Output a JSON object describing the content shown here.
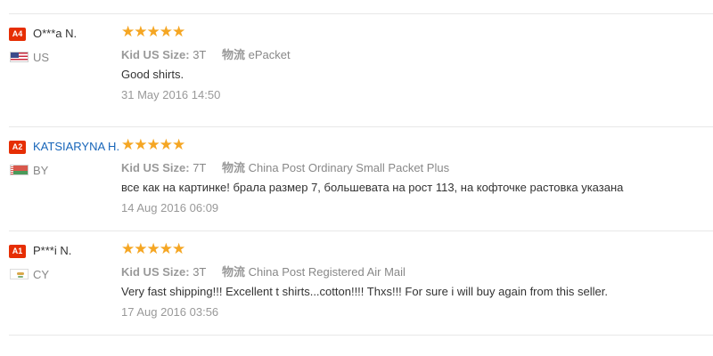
{
  "reviews": [
    {
      "badge": "A4",
      "name": "O***a N.",
      "name_is_link": false,
      "country": "US",
      "flag_icon": "us-flag-icon",
      "stars": "★★★★★",
      "rating": 5,
      "size_label": "Kid US Size:",
      "size_value": "3T",
      "shipping_label": "物流",
      "shipping_value": "ePacket",
      "feedback": "Good shirts.",
      "date": "31 May 2016 14:50"
    },
    {
      "badge": "A2",
      "name": "KATSIARYNA H.",
      "name_is_link": true,
      "country": "BY",
      "flag_icon": "by-flag-icon",
      "stars": "★★★★★",
      "rating": 5,
      "size_label": "Kid US Size:",
      "size_value": "7T",
      "shipping_label": "物流",
      "shipping_value": "China Post Ordinary Small Packet Plus",
      "feedback": "все как на картинке! брала размер 7, большевата на рост 113, на кофточке растовка указана",
      "date": "14 Aug 2016 06:09"
    },
    {
      "badge": "A1",
      "name": "P***i N.",
      "name_is_link": false,
      "country": "CY",
      "flag_icon": "cy-flag-icon",
      "stars": "★★★★★",
      "rating": 5,
      "size_label": "Kid US Size:",
      "size_value": "3T",
      "shipping_label": "物流",
      "shipping_value": "China Post Registered Air Mail",
      "feedback": "Very fast shipping!!! Excellent t shirts...cotton!!!! Thxs!!! For sure i will buy again from this seller.",
      "date": "17 Aug 2016 03:56"
    }
  ],
  "colors": {
    "badge": "#e62e04",
    "star": "#f5a623",
    "link": "#1765b9",
    "muted": "#999999"
  }
}
